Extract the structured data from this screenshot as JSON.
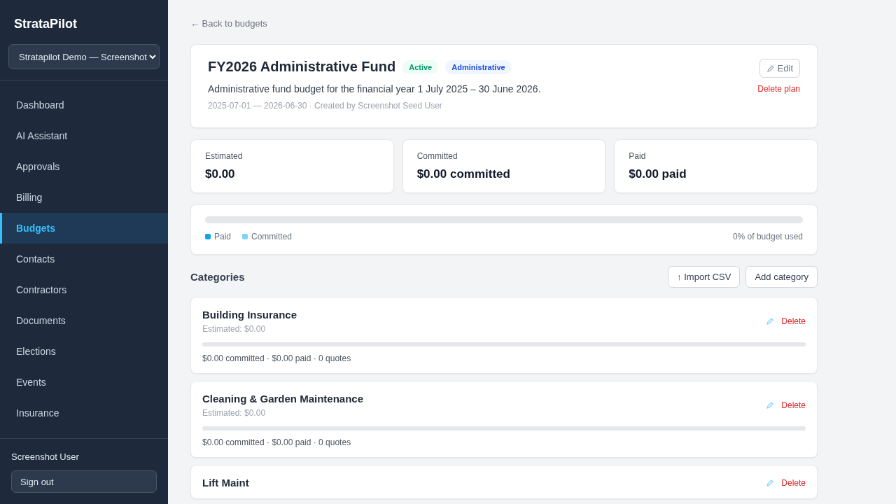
{
  "sidebar": {
    "brand": "StrataPilot",
    "org_select": {
      "value": "Stratapilot Demo — Screenshot"
    },
    "items": [
      {
        "label": "Dashboard",
        "selected": false
      },
      {
        "label": "AI Assistant",
        "selected": false
      },
      {
        "label": "Approvals",
        "selected": false
      },
      {
        "label": "Billing",
        "selected": false
      },
      {
        "label": "Budgets",
        "selected": true
      },
      {
        "label": "Contacts",
        "selected": false
      },
      {
        "label": "Contractors",
        "selected": false
      },
      {
        "label": "Documents",
        "selected": false
      },
      {
        "label": "Elections",
        "selected": false
      },
      {
        "label": "Events",
        "selected": false
      },
      {
        "label": "Insurance",
        "selected": false
      }
    ],
    "user": "Screenshot User",
    "sign_out": "Sign out"
  },
  "back_link": "← Back to budgets",
  "plan": {
    "title": "FY2026 Administrative Fund",
    "badges": [
      {
        "label": "Active",
        "kind": "status"
      },
      {
        "label": "Administrative",
        "kind": "type"
      }
    ],
    "description": "Administrative fund budget for the financial year 1 July 2025 – 30 June 2026.",
    "meta": "2025-07-01 — 2026-06-30 · Created by Screenshot Seed User",
    "edit": "Edit",
    "delete": "Delete plan"
  },
  "stats": [
    {
      "label": "Estimated",
      "value": "$0.00"
    },
    {
      "label": "Committed",
      "value": "$0.00 committed"
    },
    {
      "label": "Paid",
      "value": "$0.00 paid"
    }
  ],
  "usage": {
    "level": 0,
    "legend": [
      {
        "label": "Paid",
        "color": "#0ea5e9"
      },
      {
        "label": "Committed",
        "color": "#7dd3fc"
      }
    ],
    "summary": "0% of budget used"
  },
  "categories": {
    "heading": "Categories",
    "import": "↑ Import CSV",
    "add": "Add category",
    "items": [
      {
        "name": "Building Insurance",
        "estimated": "Estimated: $0.00",
        "level": 0,
        "summary": "$0.00 committed · $0.00 paid · 0 quotes",
        "delete": "Delete"
      },
      {
        "name": "Cleaning & Garden Maintenance",
        "estimated": "Estimated: $0.00",
        "level": 0,
        "summary": "$0.00 committed · $0.00 paid · 0 quotes",
        "delete": "Delete"
      },
      {
        "name": "Lift Maint",
        "delete": "Delete"
      }
    ]
  }
}
